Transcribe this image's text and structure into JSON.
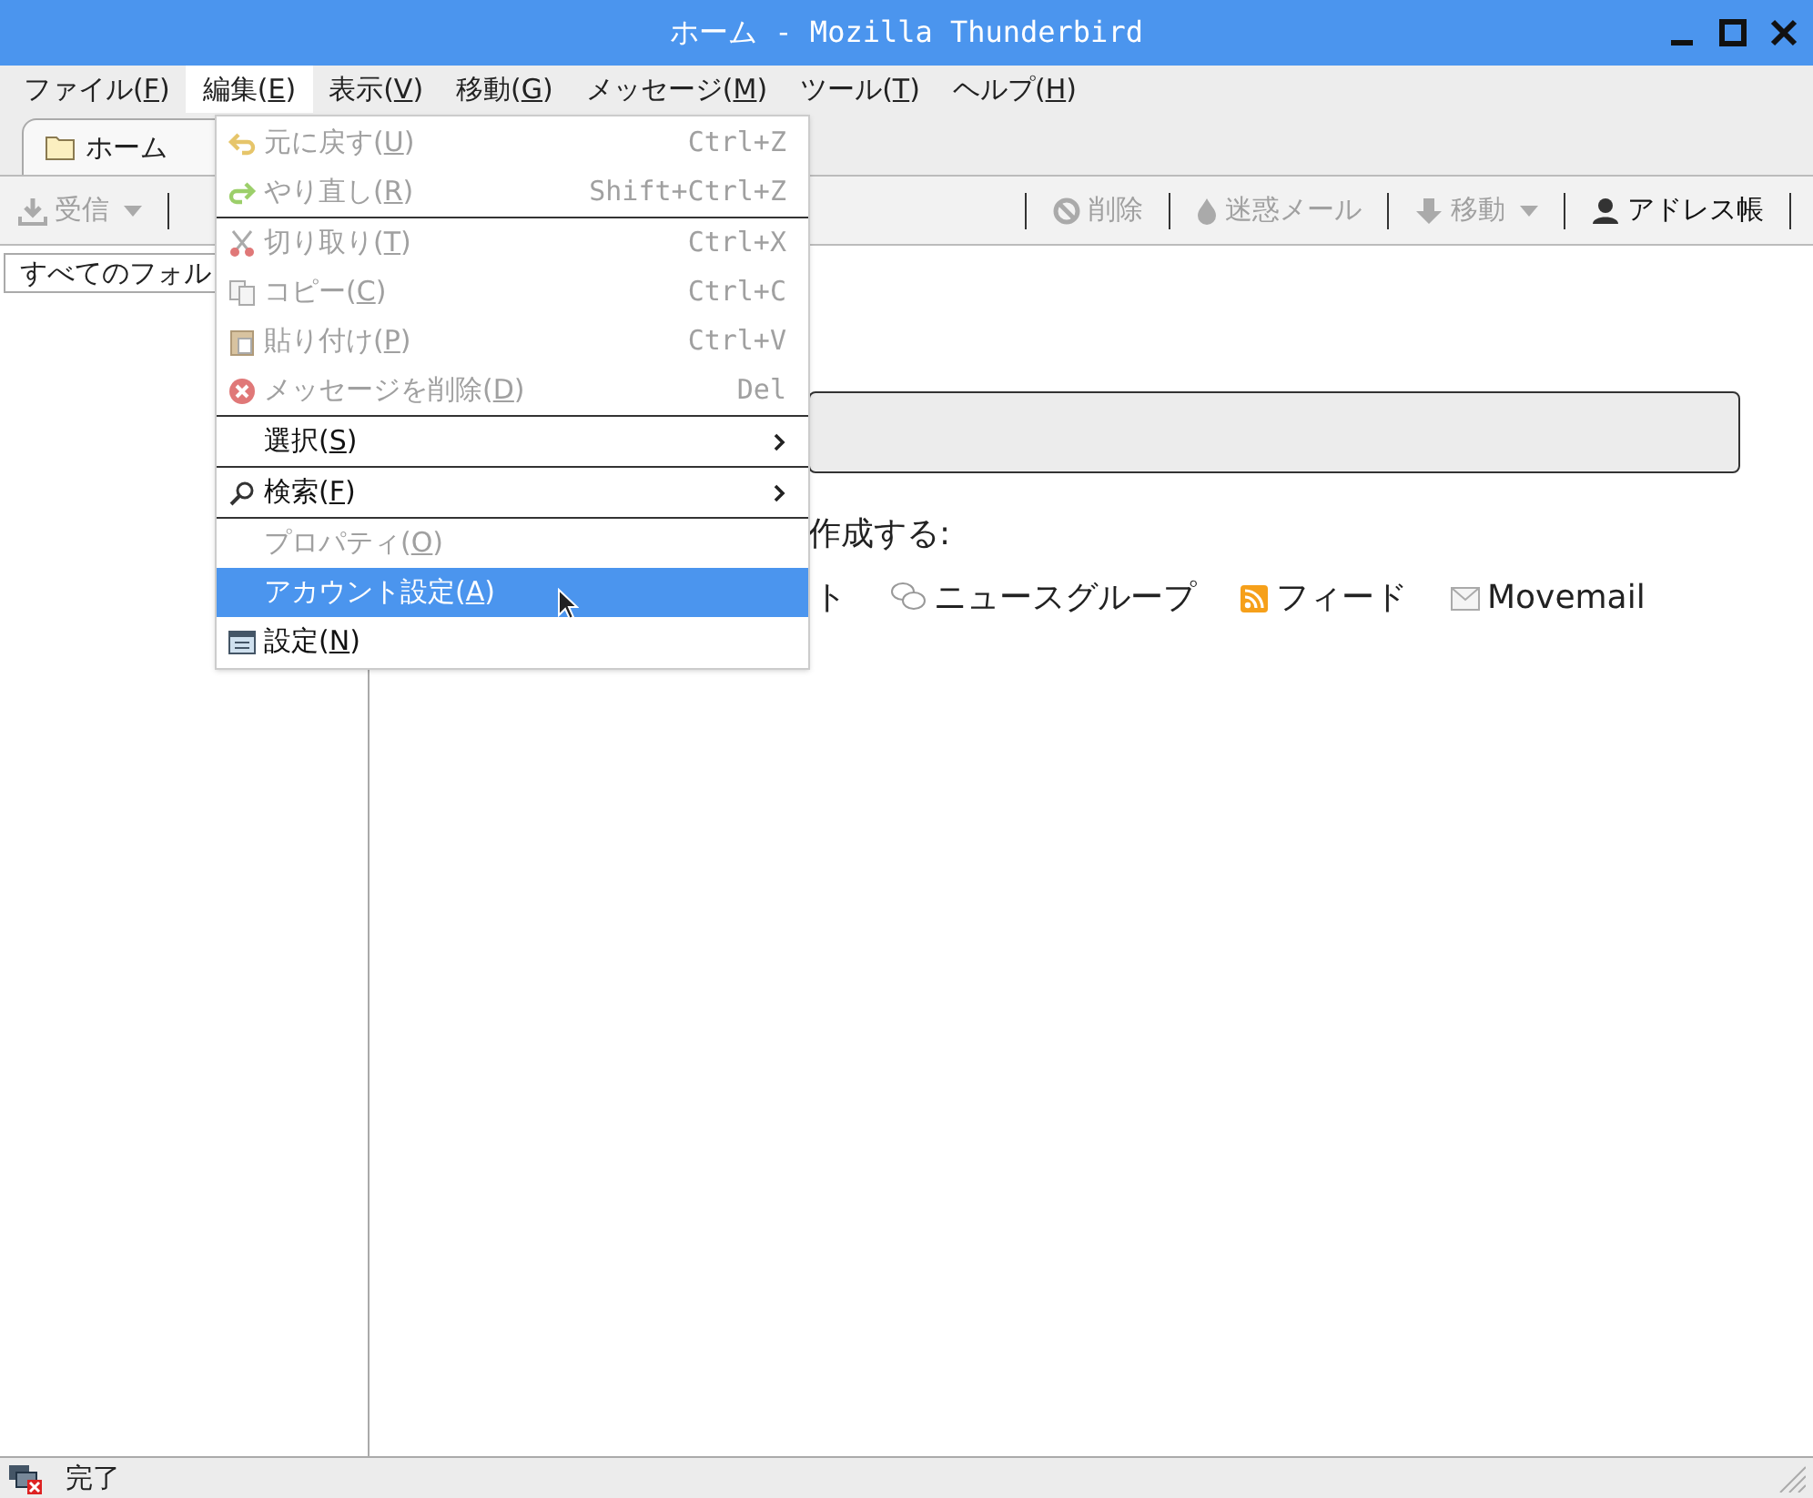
{
  "window": {
    "title": "ホーム - Mozilla Thunderbird"
  },
  "menubar": [
    {
      "label": [
        "ファイル(",
        "F",
        ")"
      ],
      "selected": false
    },
    {
      "label": [
        "編集(",
        "E",
        ")"
      ],
      "selected": true
    },
    {
      "label": [
        "表示(",
        "V",
        ")"
      ],
      "selected": false
    },
    {
      "label": [
        "移動(",
        "G",
        ")"
      ],
      "selected": false
    },
    {
      "label": [
        "メッセージ(",
        "M",
        ")"
      ],
      "selected": false
    },
    {
      "label": [
        "ツール(",
        "T",
        ")"
      ],
      "selected": false
    },
    {
      "label": [
        "ヘルプ(",
        "H",
        ")"
      ],
      "selected": false
    }
  ],
  "tabs": [
    {
      "label": "ホーム",
      "selected": true
    }
  ],
  "toolbar": [
    {
      "kind": "button",
      "label": "受信",
      "disabled": true,
      "dropdown": true
    },
    {
      "kind": "separator"
    },
    {
      "kind": "spacer"
    },
    {
      "kind": "separator"
    },
    {
      "kind": "button",
      "label": "削除",
      "disabled": true,
      "dropdown": false
    },
    {
      "kind": "separator"
    },
    {
      "kind": "button",
      "label": "迷惑メール",
      "disabled": true,
      "dropdown": false
    },
    {
      "kind": "separator"
    },
    {
      "kind": "button",
      "label": "移動",
      "disabled": true,
      "dropdown": true
    },
    {
      "kind": "separator"
    },
    {
      "kind": "button",
      "label": "アドレス帳",
      "disabled": false,
      "dropdown": false
    },
    {
      "kind": "separator"
    }
  ],
  "folder_pane": {
    "header": "すべてのフォル"
  },
  "edit_menu": [
    {
      "kind": "item",
      "label": [
        "元に戻す(",
        "U",
        ")"
      ],
      "shortcut": "Ctrl+Z",
      "disabled": true,
      "selected": false,
      "submenu": false
    },
    {
      "kind": "item",
      "label": [
        "やり直し(",
        "R",
        ")"
      ],
      "shortcut": "Shift+Ctrl+Z",
      "disabled": true,
      "selected": false,
      "submenu": false
    },
    {
      "kind": "separator"
    },
    {
      "kind": "item",
      "label": [
        "切り取り(",
        "T",
        ")"
      ],
      "shortcut": "Ctrl+X",
      "disabled": true,
      "selected": false,
      "submenu": false
    },
    {
      "kind": "item",
      "label": [
        "コピー(",
        "C",
        ")"
      ],
      "shortcut": "Ctrl+C",
      "disabled": true,
      "selected": false,
      "submenu": false
    },
    {
      "kind": "item",
      "label": [
        "貼り付け(",
        "P",
        ")"
      ],
      "shortcut": "Ctrl+V",
      "disabled": true,
      "selected": false,
      "submenu": false
    },
    {
      "kind": "item",
      "label": [
        "メッセージを削除(",
        "D",
        ")"
      ],
      "shortcut": "Del",
      "disabled": true,
      "selected": false,
      "submenu": false
    },
    {
      "kind": "separator"
    },
    {
      "kind": "item",
      "label": [
        "選択(",
        "S",
        ")"
      ],
      "disabled": false,
      "selected": false,
      "submenu": true
    },
    {
      "kind": "separator"
    },
    {
      "kind": "item",
      "label": [
        "検索(",
        "F",
        ")"
      ],
      "disabled": false,
      "selected": false,
      "submenu": true
    },
    {
      "kind": "separator"
    },
    {
      "kind": "item",
      "label": [
        "プロパティ(",
        "O",
        ")"
      ],
      "disabled": true,
      "selected": false,
      "submenu": false
    },
    {
      "kind": "item",
      "label": [
        "アカウント設定(",
        "A",
        ")"
      ],
      "disabled": false,
      "selected": true,
      "submenu": false
    },
    {
      "kind": "item",
      "label": [
        "設定(",
        "N",
        ")"
      ],
      "disabled": false,
      "selected": false,
      "submenu": false
    }
  ],
  "content": {
    "create_heading": "作成する:",
    "create_items": [
      {
        "label": "ト"
      },
      {
        "label": "ニュースグループ"
      },
      {
        "label": "フィード"
      },
      {
        "label": "Movemail"
      }
    ]
  },
  "status_bar": {
    "text": "完了"
  }
}
